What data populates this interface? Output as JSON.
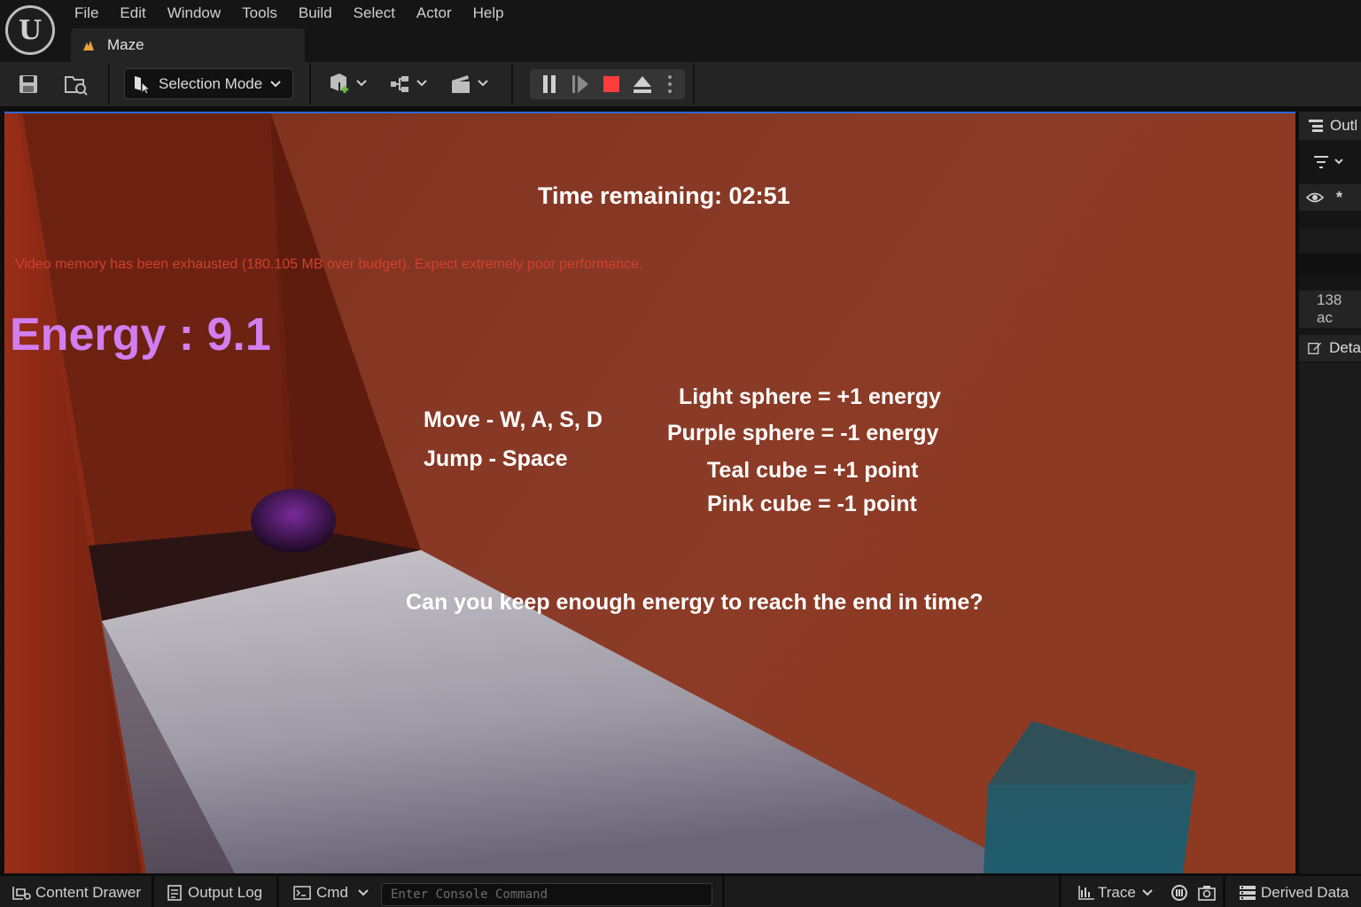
{
  "app": {
    "logo_glyph": "U",
    "menu": [
      "File",
      "Edit",
      "Window",
      "Tools",
      "Build",
      "Select",
      "Actor",
      "Help"
    ],
    "document_tab": "Maze",
    "accent_color": "#e8a33c"
  },
  "toolbar": {
    "mode_label": "Selection Mode",
    "stop_color": "#ff3d3d"
  },
  "viewport": {
    "hud": {
      "timer": "Time remaining: 02:51",
      "vram_warning": "Video memory has been exhausted (180.105 MB over budget). Expect extremely poor performance.",
      "energy": "Energy :  9.1",
      "energy_color": "#d17ef0",
      "controls": [
        "Move - W, A, S, D",
        "Jump - Space"
      ],
      "legend": [
        "Light sphere = +1 energy",
        "Purple sphere = -1 energy",
        "Teal cube = +1 point",
        "Pink cube = -1 point"
      ],
      "question": "Can you keep enough energy to reach the end in time?"
    }
  },
  "right_panel": {
    "outliner_tab": "Outl",
    "actor_count": "138 ac",
    "details_tab": "Deta"
  },
  "statusbar": {
    "content_drawer": "Content Drawer",
    "output_log": "Output Log",
    "cmd": "Cmd",
    "console_placeholder": "Enter Console Command",
    "trace": "Trace",
    "derived_data": "Derived Data"
  }
}
